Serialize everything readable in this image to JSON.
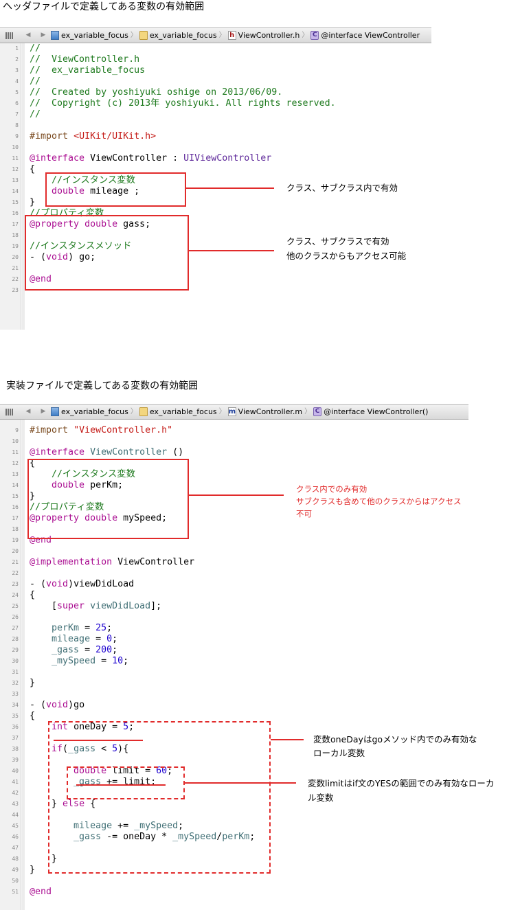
{
  "section1": {
    "heading": "ヘッダファイルで定義してある変数の有効範囲",
    "jumpbar": {
      "crumbs": [
        "ex_variable_focus",
        "ex_variable_focus",
        "ViewController.h",
        "@interface ViewController"
      ]
    },
    "line_numbers": [
      "1",
      "2",
      "3",
      "4",
      "5",
      "6",
      "7",
      "8",
      "9",
      "10",
      "11",
      "12",
      "13",
      "14",
      "15",
      "16",
      "17",
      "18",
      "19",
      "20",
      "21",
      "22",
      "23"
    ],
    "notes": {
      "instance_var": "クラス、サブクラス内で有効",
      "property_line1": "クラス、サブクラスで有効",
      "property_line2": "他のクラスからもアクセス可能"
    }
  },
  "section2": {
    "heading": "実装ファイルで定義してある変数の有効範囲",
    "jumpbar": {
      "crumbs": [
        "ex_variable_focus",
        "ex_variable_focus",
        "ViewController.m",
        "@interface ViewController()"
      ]
    },
    "line_numbers": [
      "9",
      "10",
      "11",
      "12",
      "13",
      "14",
      "15",
      "16",
      "17",
      "18",
      "19",
      "20",
      "21",
      "22",
      "23",
      "24",
      "25",
      "26",
      "27",
      "28",
      "29",
      "30",
      "31",
      "32",
      "33",
      "34",
      "35",
      "36",
      "37",
      "38",
      "39",
      "40",
      "41",
      "42",
      "43",
      "44",
      "45",
      "46",
      "47",
      "48",
      "49",
      "50",
      "51"
    ],
    "notes": {
      "private_line1": "クラス内でのみ有効",
      "private_line2": "サブクラスも含めて他のクラスからはアクセス",
      "private_line3": "不可",
      "oneday_line1": "変数oneDayはgoメソッド内でのみ有効な",
      "oneday_line2": "ローカル変数",
      "limit_line1": "変数limitはif文のYESの範囲でのみ有効なローカ",
      "limit_line2": "ル変数"
    }
  },
  "colors": {
    "annotation": "#e12b2b",
    "comment": "#1e7a1e",
    "keyword": "#aa0d91",
    "number": "#1c00cf",
    "string": "#c41a16"
  }
}
